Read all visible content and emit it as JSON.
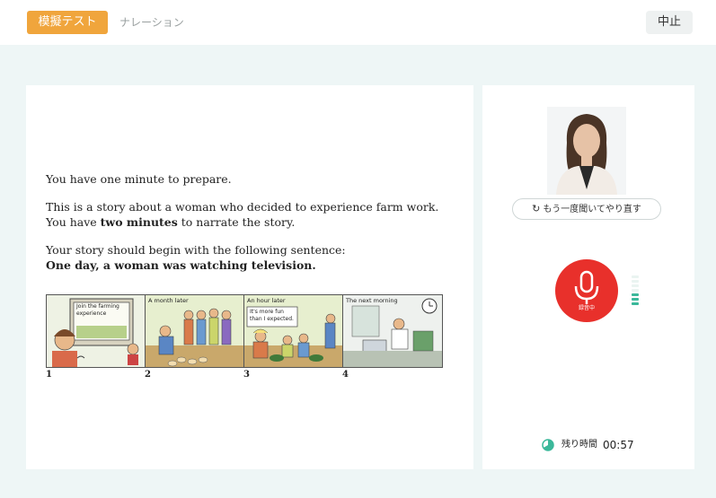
{
  "header": {
    "active_tab": "模擬テスト",
    "inactive_tab": "ナレーション",
    "stop_label": "中止"
  },
  "instructions": {
    "prepare": "You have one minute to prepare.",
    "story_line1": "This is a story about a woman who decided to experience farm work.",
    "story_line2_prefix": "You have ",
    "story_line2_bold": "two minutes",
    "story_line2_suffix": " to narrate the story.",
    "begin_line": "Your story should begin with the following sentence:",
    "begin_sentence": "One day, a woman was watching television."
  },
  "comic": {
    "panels": [
      {
        "number": "1",
        "caption": "",
        "tv_text": "Join the farming experience"
      },
      {
        "number": "2",
        "caption": "A month later"
      },
      {
        "number": "3",
        "caption": "An hour later",
        "speech": "It's more fun than I expected."
      },
      {
        "number": "4",
        "caption": "The next morning"
      }
    ]
  },
  "right": {
    "replay_label": "もう一度聞いてやり直す",
    "recording_label": "録音中",
    "timer_label": "残り時間",
    "timer_value": "00:57"
  },
  "colors": {
    "accent": "#f0a53c",
    "record": "#e8302b",
    "meter": "#3bb89a"
  }
}
